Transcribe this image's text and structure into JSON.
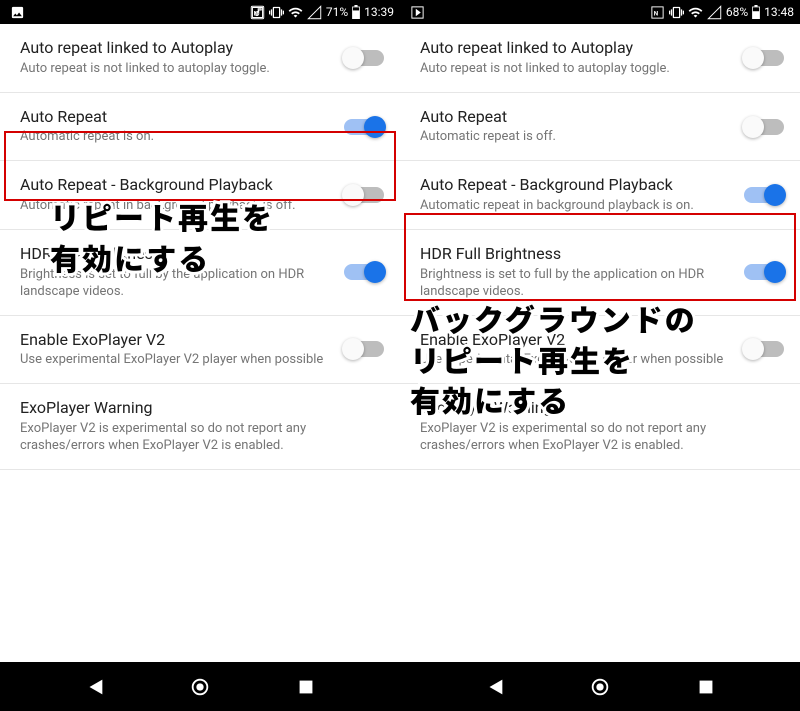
{
  "statusbar": {
    "left": {
      "battery": "71%",
      "time": "13:39"
    },
    "right": {
      "battery": "68%",
      "time": "13:48"
    }
  },
  "left": {
    "rows": [
      {
        "title": "Auto repeat linked to Autoplay",
        "subtitle": "Auto repeat is not linked to autoplay toggle.",
        "toggle": "off"
      },
      {
        "title": "Auto Repeat",
        "subtitle": "Automatic repeat is on.",
        "toggle": "on"
      },
      {
        "title": "Auto Repeat - Background Playback",
        "subtitle": "Automatic repeat in background playback is off.",
        "toggle": "off"
      },
      {
        "title": "HDR Full Brightness",
        "subtitle": "Brightness is set to full by the application on HDR landscape videos.",
        "toggle": "on"
      },
      {
        "title": "Enable ExoPlayer V2",
        "subtitle": "Use experimental ExoPlayer V2 player when possible",
        "toggle": "off"
      },
      {
        "title": "ExoPlayer Warning",
        "subtitle": "ExoPlayer V2 is experimental so do not report any crashes/errors when ExoPlayer V2 is enabled."
      }
    ]
  },
  "right": {
    "rows": [
      {
        "title": "Auto repeat linked to Autoplay",
        "subtitle": "Auto repeat is not linked to autoplay toggle.",
        "toggle": "off"
      },
      {
        "title": "Auto Repeat",
        "subtitle": "Automatic repeat is off.",
        "toggle": "off"
      },
      {
        "title": "Auto Repeat - Background Playback",
        "subtitle": "Automatic repeat in background playback is on.",
        "toggle": "on"
      },
      {
        "title": "HDR Full Brightness",
        "subtitle": "Brightness is set to full by the application on HDR landscape videos.",
        "toggle": "on"
      },
      {
        "title": "Enable ExoPlayer V2",
        "subtitle": "Use experimental ExoPlayer V2 player when possible",
        "toggle": "off"
      },
      {
        "title": "ExoPlayer Warning",
        "subtitle": "ExoPlayer V2 is experimental so do not report any crashes/errors when ExoPlayer V2 is enabled."
      }
    ]
  },
  "annotations": {
    "left_line1": "リピート再生を",
    "left_line2": "有効にする",
    "right_line1": "バックグラウンドの",
    "right_line2": "リピート再生を",
    "right_line3": "有効にする"
  }
}
